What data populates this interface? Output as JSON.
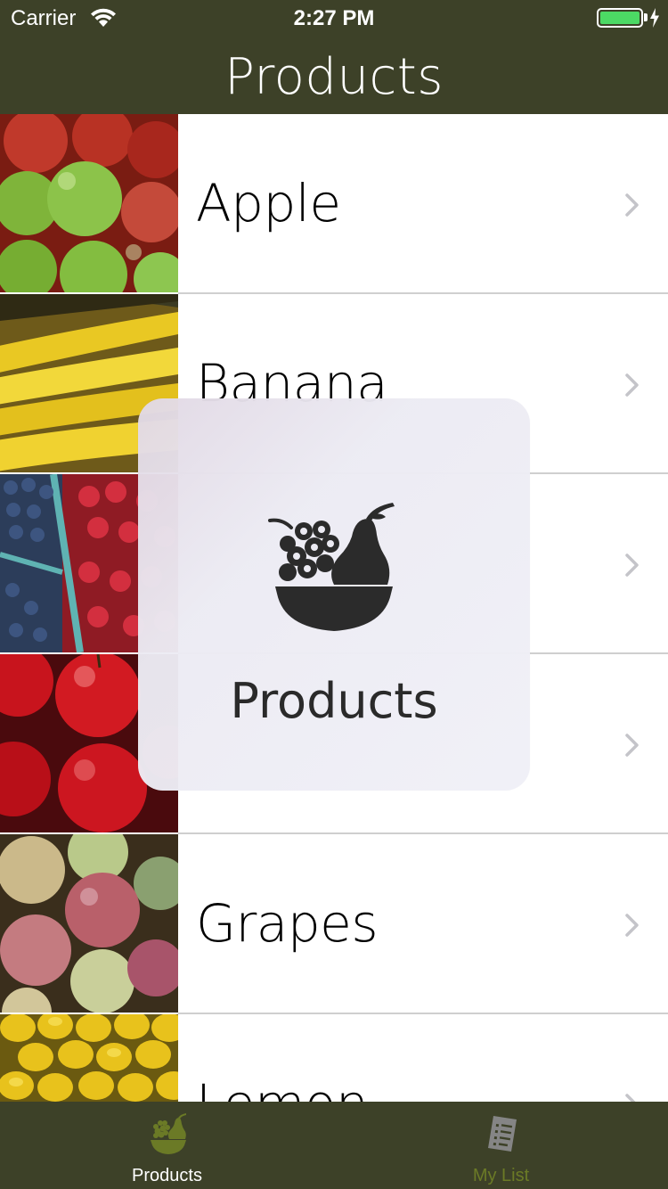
{
  "status_bar": {
    "carrier": "Carrier",
    "time": "2:27 PM",
    "icons": [
      "wifi-icon",
      "battery-icon",
      "charging-bolt-icon"
    ]
  },
  "nav_bar": {
    "title": "Products"
  },
  "products": [
    {
      "label": "Apple",
      "image": "apples-photo"
    },
    {
      "label": "Banana",
      "image": "bananas-photo"
    },
    {
      "label": "",
      "image": "berries-photo"
    },
    {
      "label": "",
      "image": "red-fruit-photo"
    },
    {
      "label": "Grapes",
      "image": "grapes-photo"
    },
    {
      "label": "Lemon",
      "image": "lemons-photo"
    }
  ],
  "hud": {
    "icon": "fruit-basket-icon",
    "label": "Products"
  },
  "tab_bar": {
    "tabs": [
      {
        "label": "Products",
        "icon": "fruit-basket-icon",
        "selected": true
      },
      {
        "label": "My List",
        "icon": "list-document-icon",
        "selected": false
      }
    ]
  },
  "colors": {
    "bar_background": "#3d4128",
    "selected_tab": "#ffffff",
    "unselected_tab": "#6b7a26",
    "separator": "#cfcfcf",
    "battery": "#4cd964"
  }
}
